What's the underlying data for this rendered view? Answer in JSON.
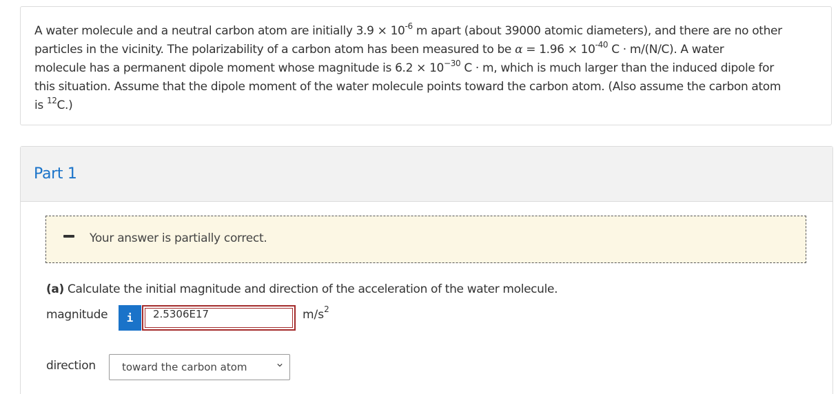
{
  "question": {
    "line1_pre": "A water molecule and a neutral carbon atom are initially 3.9 × 10",
    "line1_exp1": "-6",
    "line1_post": " m apart (about 39000 atomic diameters), and there are no other",
    "line2_pre": "particles in the vicinity. The polarizability of a carbon atom has been measured to be ",
    "alpha_symbol": "α",
    "line2_mid": " =  1.96 × 10",
    "line2_exp": "-40",
    "line2_post": " C · m/(N/C). A water",
    "line3_pre": "molecule has a permanent dipole moment whose magnitude is 6.2 × 10",
    "line3_exp": "−30",
    "line3_post": " C · m, which is much larger than the induced dipole for",
    "line4": "this situation. Assume that the dipole moment of the water molecule points toward the carbon atom. (Also assume the carbon atom",
    "line5_pre": "is ",
    "line5_sup": "12",
    "line5_post": "C.)"
  },
  "part": {
    "title": "Part 1",
    "feedback": "Your answer is partially correct.",
    "prompt_label": "(a)",
    "prompt_text": " Calculate the initial magnitude and direction of the acceleration of the water molecule.",
    "magnitude_label": "magnitude",
    "info_icon_glyph": "i",
    "magnitude_value": "2.5306E17",
    "unit_base": "m/s",
    "unit_exp": "2",
    "direction_label": "direction",
    "direction_value": "toward the carbon atom"
  },
  "colors": {
    "accent": "#1a73c9",
    "error_border": "#a32a2a",
    "feedback_bg": "#fcf7e4"
  }
}
